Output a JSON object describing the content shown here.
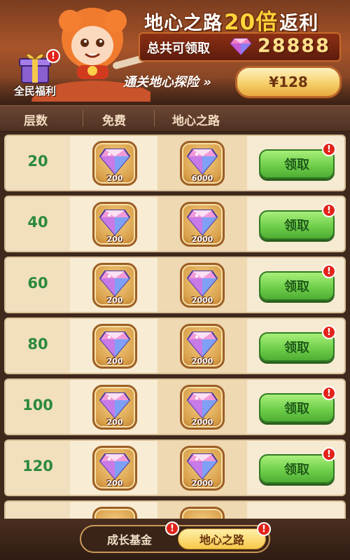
{
  "banner": {
    "title_prefix": "地心之路",
    "title_multiplier": "20倍",
    "title_suffix": "返利",
    "total_label": "总共可领取",
    "total_value": "28888",
    "welfare_label": "全民福利",
    "welfare_badge": "!",
    "pass_text": "通关地心探险 »",
    "price": "¥128"
  },
  "header": {
    "col_level": "层数",
    "col_free": "免费",
    "col_road": "地心之路"
  },
  "rows": [
    {
      "level": "20",
      "free_amount": "200",
      "road_amount": "6000",
      "claim_label": "领取",
      "badge": "!"
    },
    {
      "level": "40",
      "free_amount": "200",
      "road_amount": "2000",
      "claim_label": "领取",
      "badge": "!"
    },
    {
      "level": "60",
      "free_amount": "200",
      "road_amount": "2000",
      "claim_label": "领取",
      "badge": "!"
    },
    {
      "level": "80",
      "free_amount": "200",
      "road_amount": "2000",
      "claim_label": "领取",
      "badge": "!"
    },
    {
      "level": "100",
      "free_amount": "200",
      "road_amount": "2000",
      "claim_label": "领取",
      "badge": "!"
    },
    {
      "level": "120",
      "free_amount": "200",
      "road_amount": "2000",
      "claim_label": "领取",
      "badge": "!"
    }
  ],
  "tabs": {
    "growth_fund": "成长基金",
    "growth_fund_badge": "!",
    "core_road": "地心之路",
    "core_road_badge": "!"
  },
  "colors": {
    "claim_green": "#6fcf4a",
    "level_green": "#2c8a3c",
    "badge_red": "#e2231a",
    "gold": "#f6c94a"
  },
  "icons": {
    "gem": "pink-diamond-gem-icon",
    "gift": "gift-box-icon",
    "alert": "exclamation-badge-icon"
  }
}
